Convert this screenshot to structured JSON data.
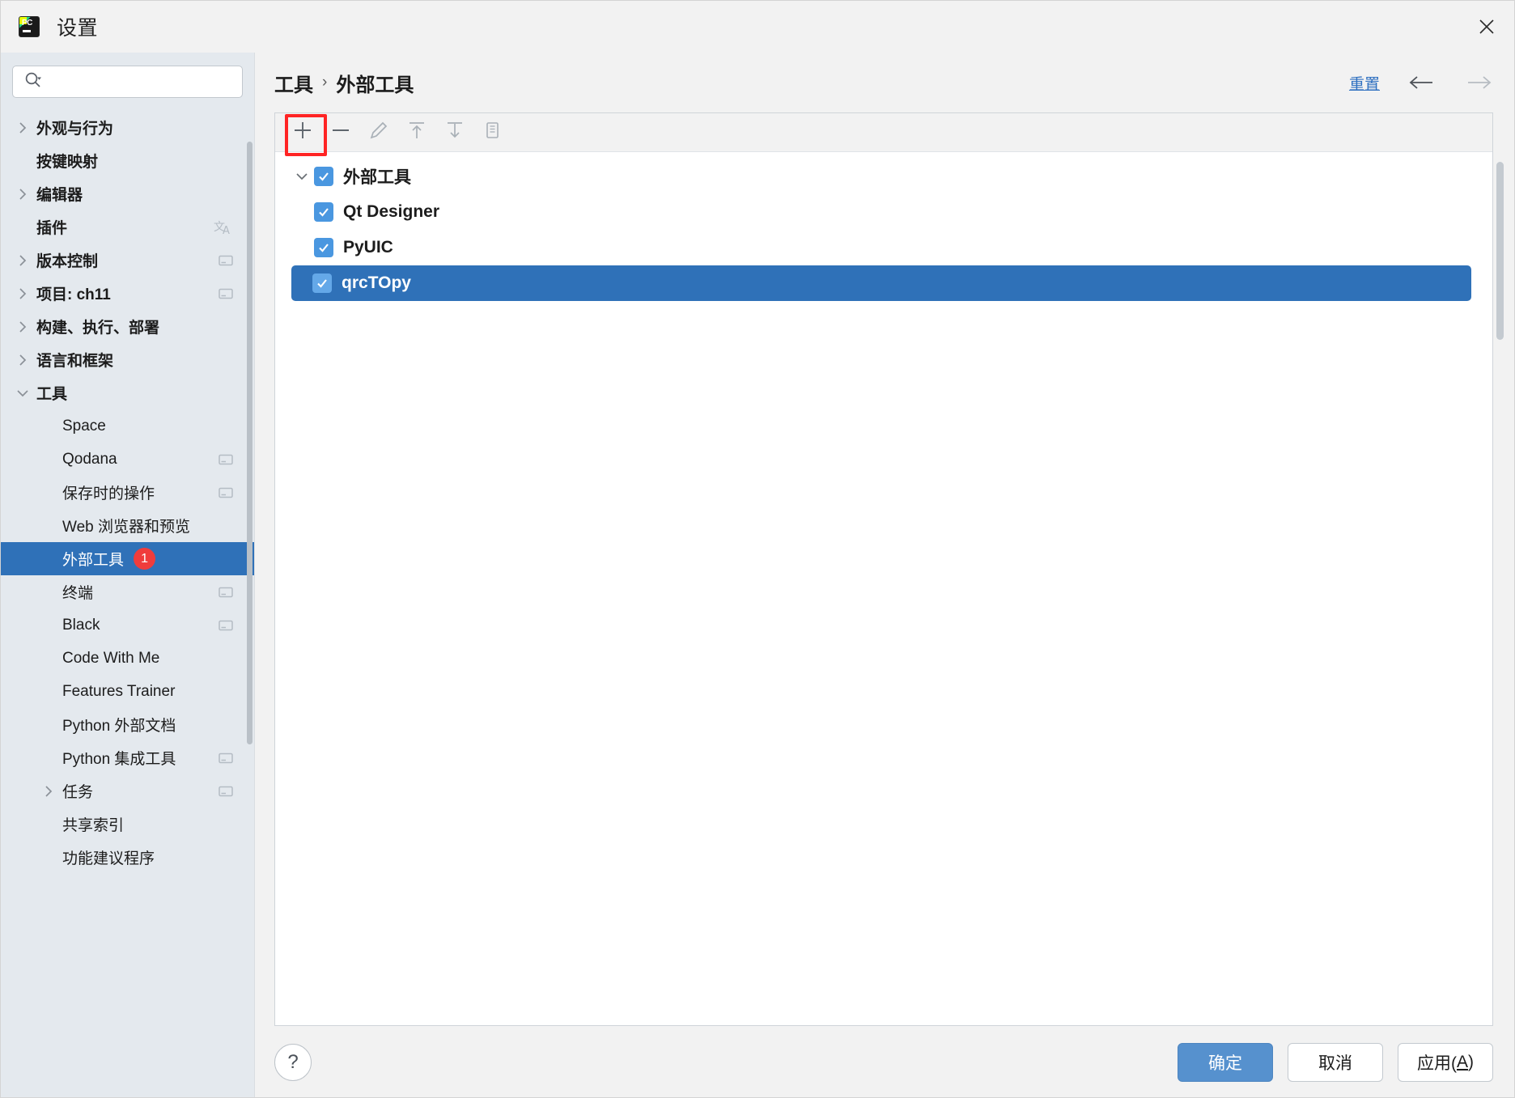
{
  "window": {
    "title": "设置",
    "app_icon": "pycharm-icon",
    "close_label": "×"
  },
  "search": {
    "placeholder": "",
    "value": "",
    "icon": "search-icon"
  },
  "sidebar": {
    "items": [
      {
        "label": "外观与行为",
        "expandable": true,
        "expanded": false,
        "bold": true,
        "indent": 0,
        "icon": null,
        "badge": null,
        "selected": false
      },
      {
        "label": "按键映射",
        "expandable": false,
        "expanded": false,
        "bold": true,
        "indent": 0,
        "icon": null,
        "badge": null,
        "selected": false
      },
      {
        "label": "编辑器",
        "expandable": true,
        "expanded": false,
        "bold": true,
        "indent": 0,
        "icon": null,
        "badge": null,
        "selected": false
      },
      {
        "label": "插件",
        "expandable": false,
        "expanded": false,
        "bold": true,
        "indent": 0,
        "icon": "translate-icon",
        "badge": null,
        "selected": false
      },
      {
        "label": "版本控制",
        "expandable": true,
        "expanded": false,
        "bold": true,
        "indent": 0,
        "icon": "project-scope-icon",
        "badge": null,
        "selected": false
      },
      {
        "label": "项目: ch11",
        "expandable": true,
        "expanded": false,
        "bold": true,
        "indent": 0,
        "icon": "project-scope-icon",
        "badge": null,
        "selected": false
      },
      {
        "label": "构建、执行、部署",
        "expandable": true,
        "expanded": false,
        "bold": true,
        "indent": 0,
        "icon": null,
        "badge": null,
        "selected": false
      },
      {
        "label": "语言和框架",
        "expandable": true,
        "expanded": false,
        "bold": true,
        "indent": 0,
        "icon": null,
        "badge": null,
        "selected": false
      },
      {
        "label": "工具",
        "expandable": true,
        "expanded": true,
        "bold": true,
        "indent": 0,
        "icon": null,
        "badge": null,
        "selected": false
      },
      {
        "label": "Space",
        "expandable": false,
        "expanded": false,
        "bold": false,
        "indent": 1,
        "icon": null,
        "badge": null,
        "selected": false
      },
      {
        "label": "Qodana",
        "expandable": false,
        "expanded": false,
        "bold": false,
        "indent": 1,
        "icon": "project-scope-icon",
        "badge": null,
        "selected": false
      },
      {
        "label": "保存时的操作",
        "expandable": false,
        "expanded": false,
        "bold": false,
        "indent": 1,
        "icon": "project-scope-icon",
        "badge": null,
        "selected": false
      },
      {
        "label": "Web 浏览器和预览",
        "expandable": false,
        "expanded": false,
        "bold": false,
        "indent": 1,
        "icon": null,
        "badge": null,
        "selected": false
      },
      {
        "label": "外部工具",
        "expandable": false,
        "expanded": false,
        "bold": false,
        "indent": 1,
        "icon": null,
        "badge": "1",
        "selected": true
      },
      {
        "label": "终端",
        "expandable": false,
        "expanded": false,
        "bold": false,
        "indent": 1,
        "icon": "project-scope-icon",
        "badge": null,
        "selected": false
      },
      {
        "label": "Black",
        "expandable": false,
        "expanded": false,
        "bold": false,
        "indent": 1,
        "icon": "project-scope-icon",
        "badge": null,
        "selected": false
      },
      {
        "label": "Code With Me",
        "expandable": false,
        "expanded": false,
        "bold": false,
        "indent": 1,
        "icon": null,
        "badge": null,
        "selected": false
      },
      {
        "label": "Features Trainer",
        "expandable": false,
        "expanded": false,
        "bold": false,
        "indent": 1,
        "icon": null,
        "badge": null,
        "selected": false
      },
      {
        "label": "Python 外部文档",
        "expandable": false,
        "expanded": false,
        "bold": false,
        "indent": 1,
        "icon": null,
        "badge": null,
        "selected": false
      },
      {
        "label": "Python 集成工具",
        "expandable": false,
        "expanded": false,
        "bold": false,
        "indent": 1,
        "icon": "project-scope-icon",
        "badge": null,
        "selected": false
      },
      {
        "label": "任务",
        "expandable": true,
        "expanded": false,
        "bold": false,
        "indent": 1,
        "icon": "project-scope-icon",
        "badge": null,
        "selected": false
      },
      {
        "label": "共享索引",
        "expandable": false,
        "expanded": false,
        "bold": false,
        "indent": 1,
        "icon": null,
        "badge": null,
        "selected": false
      },
      {
        "label": "功能建议程序",
        "expandable": false,
        "expanded": false,
        "bold": false,
        "indent": 1,
        "icon": null,
        "badge": null,
        "selected": false
      }
    ]
  },
  "main": {
    "breadcrumb": {
      "parent": "工具",
      "separator": "›",
      "current": "外部工具"
    },
    "reset_label": "重置",
    "nav": {
      "back_icon": "arrow-left-icon",
      "forward_icon": "arrow-right-icon"
    },
    "toolbar": {
      "buttons": [
        {
          "name": "add-button",
          "icon": "plus-icon",
          "enabled": true,
          "highlighted": true
        },
        {
          "name": "remove-button",
          "icon": "minus-icon",
          "enabled": true,
          "highlighted": false
        },
        {
          "name": "edit-button",
          "icon": "pencil-icon",
          "enabled": false,
          "highlighted": false
        },
        {
          "name": "move-up-button",
          "icon": "arrow-up-icon",
          "enabled": false,
          "highlighted": false
        },
        {
          "name": "move-down-button",
          "icon": "arrow-down-icon",
          "enabled": false,
          "highlighted": false
        },
        {
          "name": "copy-button",
          "icon": "copy-icon",
          "enabled": false,
          "highlighted": false
        }
      ]
    },
    "tools": [
      {
        "label": "外部工具",
        "checked": true,
        "child": false,
        "expandable": true,
        "expanded": true,
        "selected": false
      },
      {
        "label": "Qt Designer",
        "checked": true,
        "child": true,
        "expandable": false,
        "expanded": false,
        "selected": false
      },
      {
        "label": "PyUIC",
        "checked": true,
        "child": true,
        "expandable": false,
        "expanded": false,
        "selected": false
      },
      {
        "label": "qrcTOpy",
        "checked": true,
        "child": true,
        "expandable": false,
        "expanded": false,
        "selected": true
      }
    ]
  },
  "footer": {
    "help_label": "?",
    "ok_label": "确定",
    "cancel_label": "取消",
    "apply_label": "应用(A)",
    "apply_prefix": "应用(",
    "apply_mnemonic": "A",
    "apply_suffix": ")"
  },
  "colors": {
    "accent_blue": "#2f71b8",
    "link_blue": "#2d6fc0",
    "badge_red": "#f03c3c",
    "highlight_red": "#ff2424",
    "checkbox_blue": "#4a97e0",
    "sidebar_bg": "#e4e9ee",
    "panel_bg": "#ffffff"
  }
}
